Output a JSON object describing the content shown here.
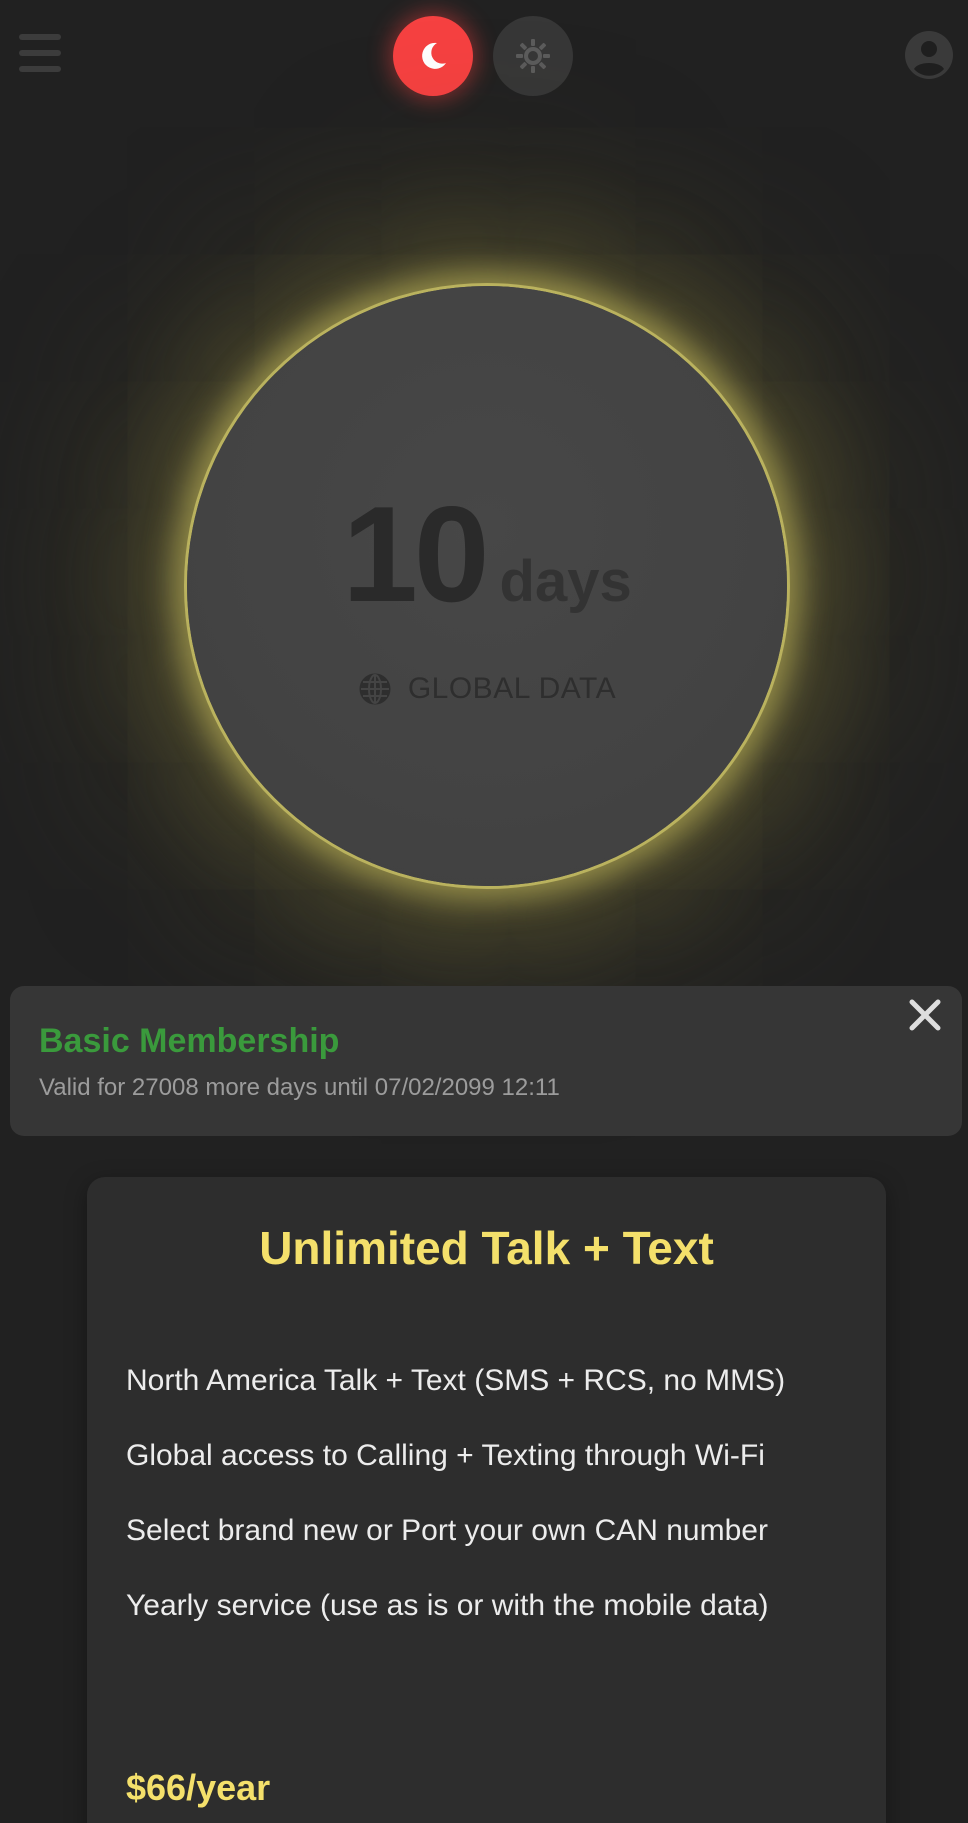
{
  "header": {
    "menu_icon": "hamburger-menu-icon",
    "dark_mode_icon": "moon-icon",
    "light_mode_icon": "sun-icon",
    "account_icon": "user-account-icon",
    "active_theme": "dark",
    "colors": {
      "dark_toggle_active": "#f64141",
      "light_toggle": "#373737"
    }
  },
  "usage": {
    "value": "10",
    "unit": "days",
    "icon": "globe-icon",
    "label": "GLOBAL DATA",
    "glow_color": "#d6cb63"
  },
  "membership": {
    "title": "Basic Membership",
    "description": "Valid for 27008 more days until 07/02/2099 12:11",
    "close_icon": "close-icon",
    "title_color": "#3a9a3c"
  },
  "plan": {
    "title": "Unlimited Talk + Text",
    "features": [
      "North America Talk + Text (SMS + RCS, no MMS)",
      "Global access to Calling + Texting through Wi-Fi",
      "Select brand new or Port your own CAN number",
      "Yearly service (use as is or with the mobile data)"
    ],
    "price": "$66/year",
    "accent_color": "#f4e06b"
  }
}
